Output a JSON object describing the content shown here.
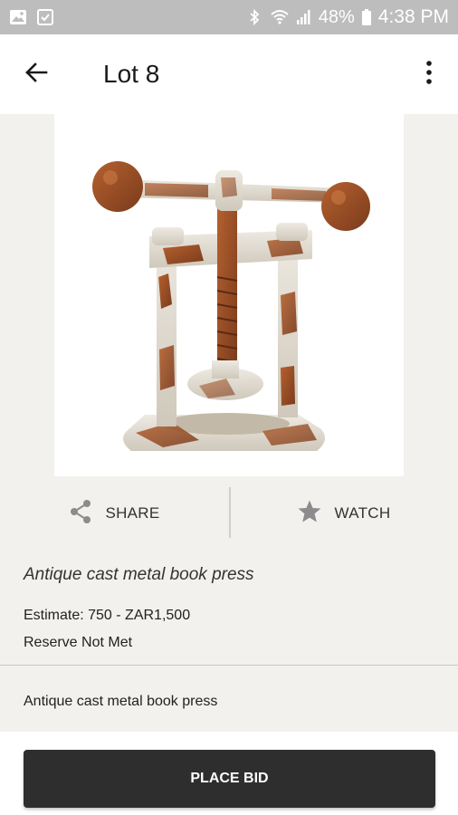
{
  "status_bar": {
    "battery_percent": "48%",
    "time": "4:38 PM",
    "icons": [
      "image-icon",
      "download-check-icon",
      "bluetooth-icon",
      "wifi-icon",
      "signal-icon",
      "battery-icon"
    ]
  },
  "app_bar": {
    "title": "Lot 8",
    "icons": [
      "back-arrow-icon",
      "overflow-menu-icon"
    ]
  },
  "lot": {
    "image_alt": "Antique cast metal book press",
    "heading": "Antique cast metal book press",
    "estimate": "Estimate: 750 - ZAR1,500",
    "reserve": "Reserve Not Met",
    "description": "Antique cast metal book press"
  },
  "actions": {
    "share_label": "SHARE",
    "watch_label": "WATCH",
    "share_icon": "share-icon",
    "watch_icon": "star-icon"
  },
  "bottom": {
    "place_bid_label": "PLACE BID"
  },
  "colors": {
    "background": "#f2f1ed",
    "status_bar": "#bdbdbd",
    "button": "#2e2e2e",
    "rust": "#a0522d",
    "metal_white": "#e8e4dc"
  }
}
